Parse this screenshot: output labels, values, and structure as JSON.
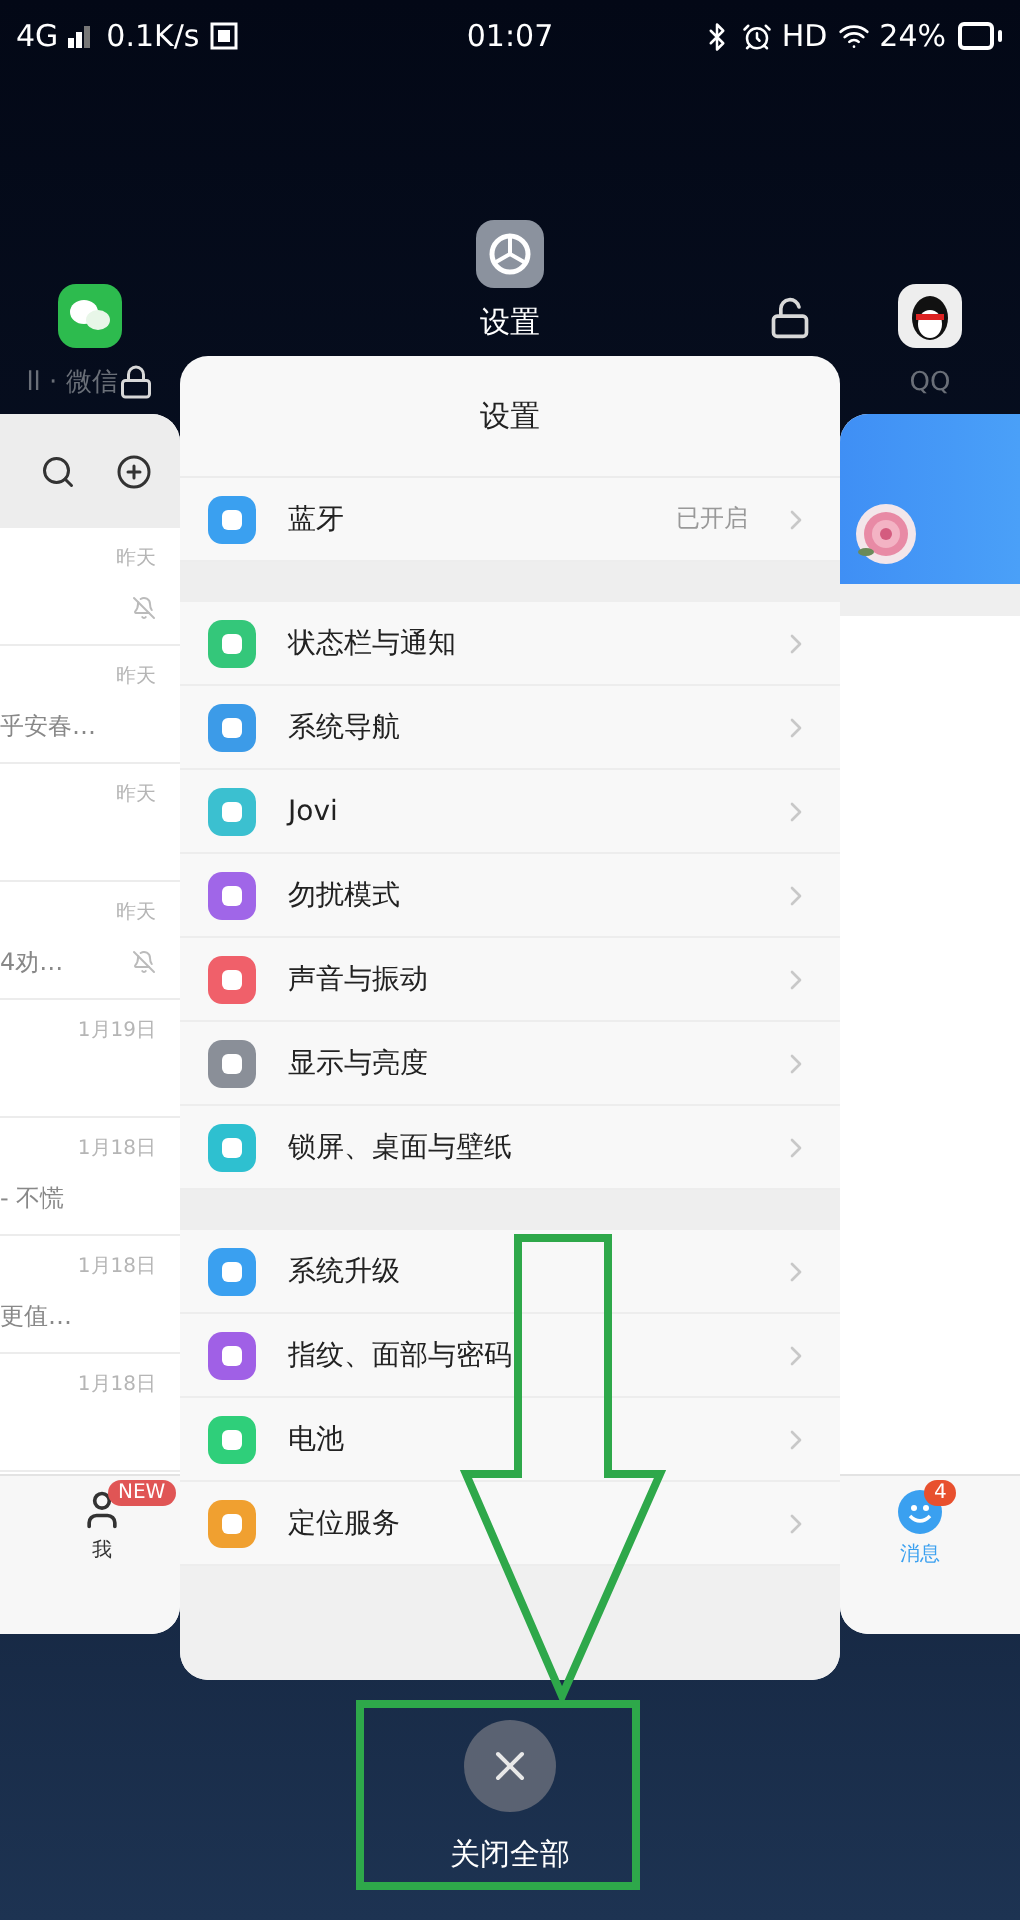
{
  "status_bar": {
    "network": "4G",
    "speed": "0.1K/s",
    "time": "01:07",
    "hd": "HD",
    "battery": "24%"
  },
  "apps": [
    {
      "name": "ll · 微信",
      "locked": true,
      "selected": false
    },
    {
      "name": "设置",
      "locked": false,
      "selected": true
    },
    {
      "name": "QQ",
      "selected": false
    }
  ],
  "wechat": {
    "rows": [
      {
        "time": "昨天",
        "muted": true
      },
      {
        "time": "昨天",
        "preview": "乎安春…",
        "muted": false
      },
      {
        "time": "昨天",
        "muted": false
      },
      {
        "time": "昨天",
        "preview": "4劝…",
        "muted": true
      },
      {
        "time": "1月19日",
        "muted": false
      },
      {
        "time": "1月18日",
        "preview": "- 不慌",
        "muted": false
      },
      {
        "time": "1月18日",
        "preview": "更值…",
        "muted": false
      },
      {
        "time": "1月18日",
        "muted": false
      }
    ],
    "tab": "我",
    "badge": "NEW"
  },
  "settings": {
    "title": "设置",
    "sections": [
      [
        {
          "label": "蓝牙",
          "value": "已开启",
          "color": "#3aa0f0"
        }
      ],
      [
        {
          "label": "状态栏与通知",
          "color": "#34c77a"
        },
        {
          "label": "系统导航",
          "color": "#3c9be8"
        },
        {
          "label": "Jovi",
          "color": "#3bc0d0"
        },
        {
          "label": "勿扰模式",
          "color": "#a066e8"
        },
        {
          "label": "声音与振动",
          "color": "#f0606a"
        },
        {
          "label": "显示与亮度",
          "color": "#8a8f98"
        },
        {
          "label": "锁屏、桌面与壁纸",
          "color": "#2ec0d0"
        }
      ],
      [
        {
          "label": "系统升级",
          "color": "#3aa0f0"
        },
        {
          "label": "指纹、面部与密码",
          "color": "#a060e6"
        },
        {
          "label": "电池",
          "color": "#2fcf7a"
        },
        {
          "label": "定位服务",
          "color": "#f0a030"
        }
      ]
    ]
  },
  "qq": {
    "tab": "消息",
    "badge": "4"
  },
  "footer": {
    "close_label": "关闭全部"
  }
}
